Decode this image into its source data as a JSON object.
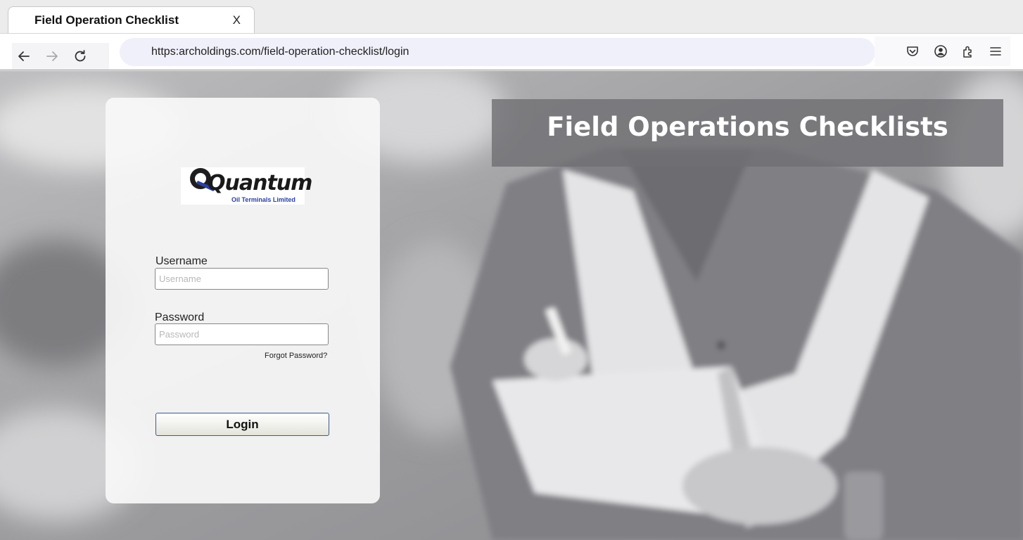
{
  "browser": {
    "tab_title": "Field Operation Checklist",
    "tab_close": "X",
    "url": "https:archoldings.com/field-operation-checklist/login",
    "nav_icons": [
      "back-arrow-icon",
      "forward-arrow-icon",
      "reload-icon"
    ],
    "toolbar_icons": [
      "pocket-icon",
      "account-icon",
      "extensions-icon",
      "menu-icon"
    ]
  },
  "login": {
    "logo_text": "Quantum",
    "logo_subtext": "Oil Terminals Limited",
    "username_label": "Username",
    "username_placeholder": "Username",
    "password_label": "Password",
    "password_placeholder": "Password",
    "forgot_link": "Forgot Password?",
    "login_button": "Login"
  },
  "hero": {
    "title": "Field Operations Checklists"
  },
  "colors": {
    "url_bar_bg": "#f0f0fb",
    "banner_bg": "#707074",
    "button_border": "#3b5a8a",
    "logo_accent": "#2a3fa0"
  }
}
